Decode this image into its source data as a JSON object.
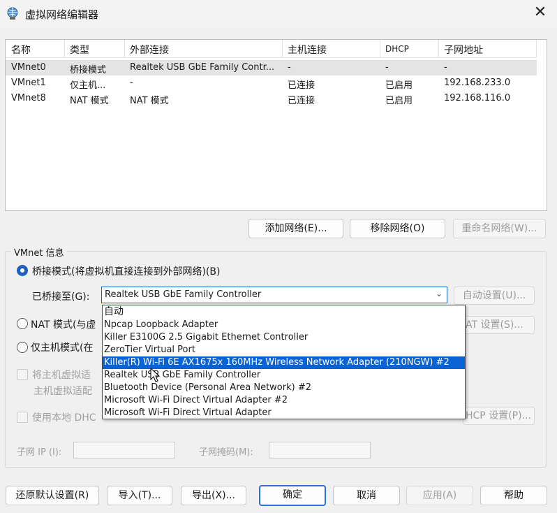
{
  "window": {
    "title": "虚拟网络编辑器",
    "close": "✕"
  },
  "table": {
    "columns": [
      "名称",
      "类型",
      "外部连接",
      "主机连接",
      "DHCP",
      "子网地址"
    ],
    "rows": [
      [
        "VMnet0",
        "桥接模式",
        "Realtek USB GbE Family Contr...",
        "-",
        "-",
        "-"
      ],
      [
        "VMnet1",
        "仅主机...",
        "-",
        "已连接",
        "已启用",
        "192.168.233.0"
      ],
      [
        "VMnet8",
        "NAT 模式",
        "NAT 模式",
        "已连接",
        "已启用",
        "192.168.116.0"
      ]
    ]
  },
  "list_buttons": {
    "add": "添加网络(E)...",
    "remove": "移除网络(O)",
    "rename": "重命名网络(W)..."
  },
  "vmnet_info": {
    "title": "VMnet 信息",
    "bridge_label": "桥接模式(将虚拟机直接连接到外部网络)(B)",
    "bridged_to_label": "已桥接至(G):",
    "bridged_to_value": "Realtek USB GbE Family Controller",
    "auto_settings": "自动设置(U)...",
    "nat_label": "NAT 模式(与虚",
    "nat_settings": "AT 设置(S)...",
    "hostonly_label": "仅主机模式(在",
    "connect_host_label": "将主机虚拟适",
    "host_adapter_label": "主机虚拟适配",
    "dhcp_label": "使用本地 DHC",
    "dhcp_settings": "HCP 设置(P)...",
    "subnet_ip_label": "子网 IP (I):",
    "subnet_mask_label": "子网掩码(M):"
  },
  "dropdown_options": [
    "自动",
    "Npcap Loopback Adapter",
    "Killer E3100G 2.5 Gigabit Ethernet Controller",
    "ZeroTier Virtual Port",
    "Killer(R) Wi-Fi 6E AX1675x 160MHz Wireless Network Adapter (210NGW) #2",
    "Realtek USB GbE Family Controller",
    "Bluetooth Device (Personal Area Network) #2",
    "Microsoft Wi-Fi Direct Virtual Adapter #2",
    "Microsoft Wi-Fi Direct Virtual Adapter"
  ],
  "highlighted_option": 4,
  "bottom_buttons": {
    "restore": "还原默认设置(R)",
    "import": "导入(T)...",
    "export": "导出(X)...",
    "ok": "确定",
    "cancel": "取消",
    "apply": "应用(A)",
    "help": "帮助"
  },
  "colors": {
    "accent": "#1f5fc2",
    "highlight": "#0a63d4"
  }
}
